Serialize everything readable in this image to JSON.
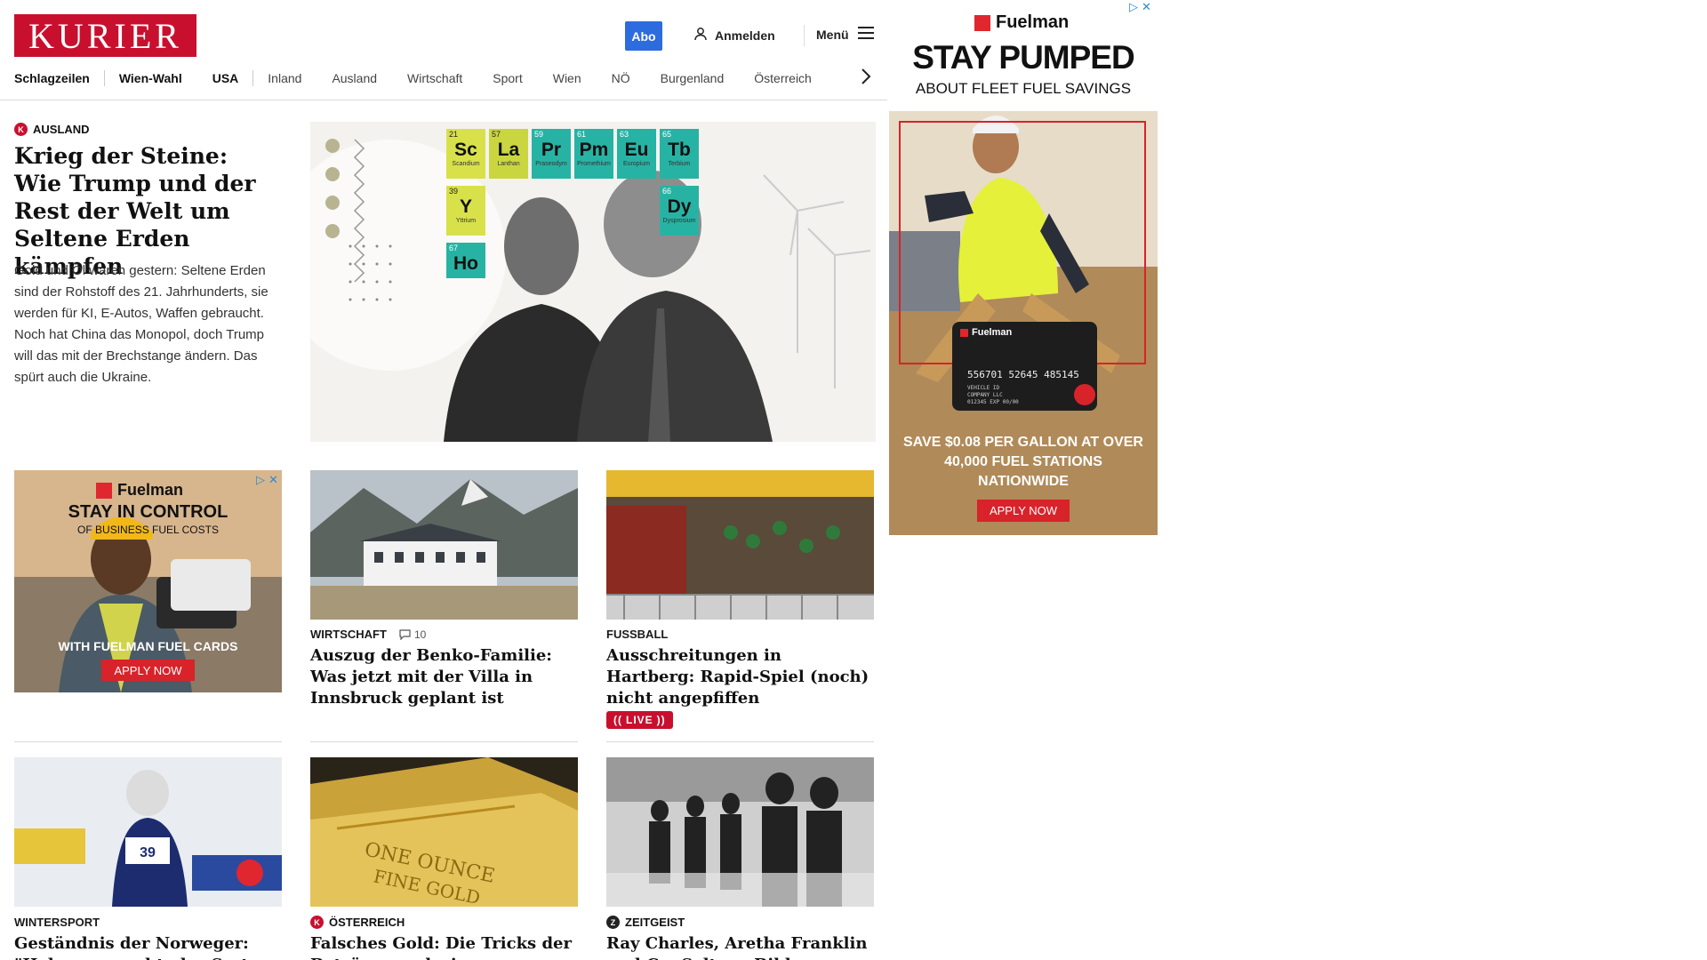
{
  "header": {
    "logo": "KURIER",
    "abo_label": "Abo",
    "login_label": "Anmelden",
    "menu_label": "Menü"
  },
  "nav": {
    "items": [
      "Schlagzeilen",
      "Wien-Wahl",
      "USA",
      "Inland",
      "Ausland",
      "Wirtschaft",
      "Sport",
      "Wien",
      "NÖ",
      "Burgenland",
      "Österreich"
    ]
  },
  "top_story": {
    "kicker": "AUSLAND",
    "title": "Krieg der Steine: Wie Trump und der Rest der Welt um Seltene Erden kämpfen",
    "teaser": "Gold und Öl waren gestern: Seltene Erden sind der Rohstoff des 21. Jahrhunderts, sie werden für KI, E-Autos, Waffen gebraucht. Noch hat China das Monopol, doch Trump will das mit der Brechstange ändern. Das spürt auch die Ukraine.",
    "hero_tiles": [
      {
        "num": "21",
        "sym": "Sc",
        "name": "Scandium",
        "color": "#d8e14a"
      },
      {
        "num": "57",
        "sym": "La",
        "name": "Lanthan",
        "color": "#c9d640"
      },
      {
        "num": "59",
        "sym": "Pr",
        "name": "Praseodym",
        "color": "#27b3a4"
      },
      {
        "num": "61",
        "sym": "Pm",
        "name": "Promethium",
        "color": "#27b3a4"
      },
      {
        "num": "63",
        "sym": "Eu",
        "name": "Europium",
        "color": "#27b3a4"
      },
      {
        "num": "65",
        "sym": "Tb",
        "name": "Terbium",
        "color": "#27b3a4"
      },
      {
        "num": "39",
        "sym": "Y",
        "name": "Yttrium",
        "color": "#d8e14a"
      },
      {
        "num": "66",
        "sym": "Dy",
        "name": "Dysprosium",
        "color": "#27b3a4"
      },
      {
        "num": "67",
        "sym": "Ho",
        "name": "",
        "color": "#27b3a4"
      }
    ]
  },
  "articles": [
    {
      "kicker": "WIRTSCHAFT",
      "comments": "10",
      "title": "Auszug der Benko-Familie: Was jetzt mit der Villa in Innsbruck geplant ist"
    },
    {
      "kicker": "FUSSBALL",
      "title": "Ausschreitungen in Hartberg: Rapid-Spiel (noch) nicht angepfiffen",
      "live": "LIVE"
    },
    {
      "kicker": "WINTERSPORT",
      "title": "Geständnis der Norweger: \"Haben versucht, das System"
    },
    {
      "kicker": "ÖSTERREICH",
      "title": "Falsches Gold: Die Tricks der Betrüger und wie man"
    },
    {
      "kicker": "ZEITGEIST",
      "title": "Ray Charles, Aretha Franklin und Co: Seltene Bilder von Legenden"
    }
  ],
  "ad_inline": {
    "brand": "Fuelman",
    "headline": "STAY IN CONTROL",
    "subline": "OF BUSINESS FUEL COSTS",
    "tagline": "WITH FUELMAN FUEL CARDS",
    "cta": "APPLY NOW"
  },
  "ad_side": {
    "brand": "Fuelman",
    "headline": "STAY PUMPED",
    "subline": "ABOUT FLEET FUEL SAVINGS",
    "card_brand": "Fuelman",
    "card_number": "556701 52645 485145",
    "card_line1": "VEHICLE ID",
    "card_line2": "COMPANY LLC",
    "card_line3": "012345          EXP 00/00",
    "offer": "SAVE $0.08 PER GALLON AT OVER 40,000 FUEL STATIONS NATIONWIDE",
    "cta": "APPLY NOW"
  },
  "colors": {
    "brand_red": "#c8102e",
    "abo_blue": "#2d6cdf",
    "live_red": "#c8102e"
  }
}
